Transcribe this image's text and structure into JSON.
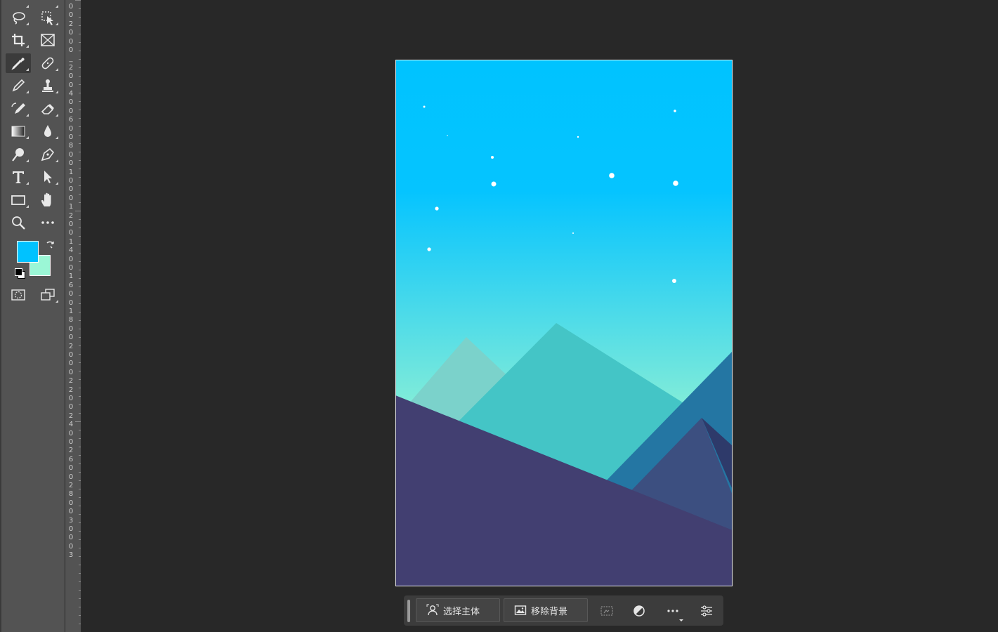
{
  "app": {
    "name": "Photoshop canvas view"
  },
  "colors": {
    "foreground": "#00c2ff",
    "background": "#9bf7d6",
    "sky_top": "#00c3ff",
    "sky_bottom": "#9dfccf",
    "mountain_back_left": "#7bd2cb",
    "mountain_center": "#44c5c6",
    "mountain_right": "#2476a3",
    "mountain_inner": "#3c4f80",
    "hill_front": "#423f71"
  },
  "toolbar": {
    "tools": [
      {
        "name": "lasso-tool",
        "icon": "lasso-icon"
      },
      {
        "name": "object-select-tool",
        "icon": "object-select-icon"
      },
      {
        "name": "crop-tool",
        "icon": "crop-icon"
      },
      {
        "name": "frame-tool",
        "icon": "frame-icon"
      },
      {
        "name": "eyedropper-tool",
        "icon": "eyedropper-icon",
        "active": true
      },
      {
        "name": "healing-brush-tool",
        "icon": "bandage-icon"
      },
      {
        "name": "brush-tool",
        "icon": "brush-icon"
      },
      {
        "name": "clone-stamp-tool",
        "icon": "stamp-icon"
      },
      {
        "name": "history-brush-tool",
        "icon": "history-brush-icon"
      },
      {
        "name": "eraser-tool",
        "icon": "eraser-icon"
      },
      {
        "name": "gradient-tool",
        "icon": "gradient-icon"
      },
      {
        "name": "blur-tool",
        "icon": "drop-icon"
      },
      {
        "name": "dodge-tool",
        "icon": "dodge-icon"
      },
      {
        "name": "pen-tool",
        "icon": "pen-icon"
      },
      {
        "name": "type-tool",
        "icon": "type-icon",
        "label": "T"
      },
      {
        "name": "path-select-tool",
        "icon": "arrow-icon"
      },
      {
        "name": "rectangle-tool",
        "icon": "rectangle-icon"
      },
      {
        "name": "hand-tool",
        "icon": "hand-icon"
      },
      {
        "name": "zoom-tool",
        "icon": "magnifier-icon"
      },
      {
        "name": "more-tools",
        "icon": "ellipsis-icon"
      }
    ]
  },
  "ruler": {
    "labels": [
      "0",
      "0",
      "2",
      "0",
      "0",
      "0",
      "_",
      "2",
      "0",
      "0",
      "4",
      "0",
      "0",
      "6",
      "0",
      "0",
      "8",
      "0",
      "0",
      "1",
      "0",
      "0",
      "0",
      "1",
      "2",
      "0",
      "0",
      "1",
      "4",
      "0",
      "0",
      "1",
      "6",
      "0",
      "0",
      "1",
      "8",
      "0",
      "0",
      "2",
      "0",
      "0",
      "0",
      "2",
      "2",
      "0",
      "0",
      "2",
      "4",
      "0",
      "0",
      "2",
      "6",
      "0",
      "0",
      "2",
      "8",
      "0",
      "0",
      "3",
      "0",
      "0",
      "0",
      "3"
    ]
  },
  "context_bar": {
    "select_subject_label": "选择主体",
    "remove_background_label": "移除背景"
  }
}
